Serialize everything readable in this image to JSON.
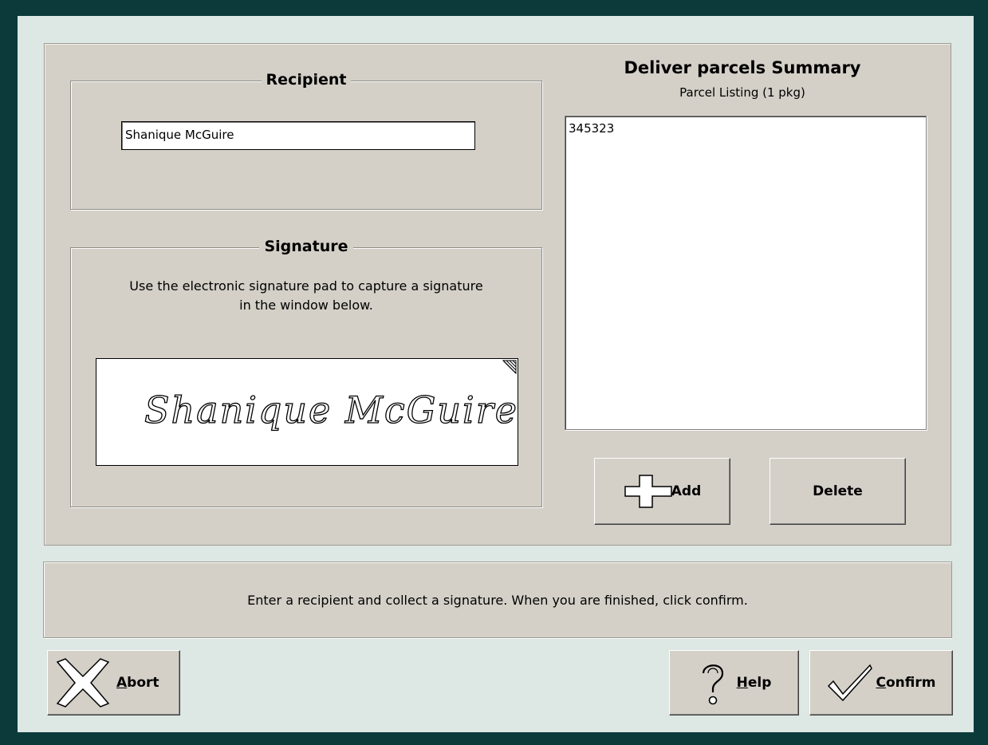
{
  "recipient": {
    "title": "Recipient",
    "name_value": "Shanique McGuire"
  },
  "signature": {
    "title": "Signature",
    "instructions_line1": "Use the electronic signature pad to capture a signature",
    "instructions_line2": "in the window below.",
    "signed_name": "Shanique McGuire"
  },
  "summary": {
    "title": "Deliver parcels Summary",
    "subtitle": "Parcel Listing  (1 pkg)",
    "parcels": [
      "345323"
    ],
    "add_label": "Add",
    "delete_label": "Delete"
  },
  "status_message": "Enter a recipient and collect a signature.  When you are finished, click confirm.",
  "footer": {
    "abort_label": "Abort",
    "abort_mnemonic": "A",
    "abort_rest": "bort",
    "help_mnemonic": "H",
    "help_rest": "elp",
    "confirm_mnemonic": "C",
    "confirm_rest": "onfirm"
  },
  "icons": [
    "plus-icon",
    "x-icon",
    "question-mark-icon",
    "checkmark-icon",
    "resize-corner-icon"
  ],
  "colors": {
    "frame": "#0c3a3a",
    "window_bg": "#dde7e3",
    "panel_bg": "#d4d0c8"
  }
}
